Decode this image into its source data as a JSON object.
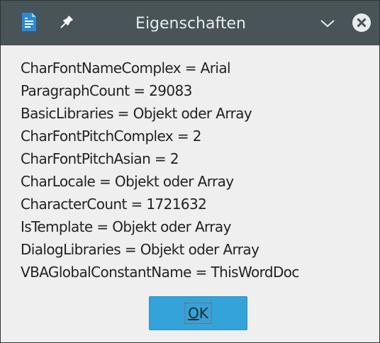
{
  "window": {
    "title": "Eigenschaften",
    "icons": {
      "app": "document-icon",
      "pin": "pin-icon",
      "menu": "chevron-down-icon",
      "close": "close-icon"
    }
  },
  "properties": [
    "CharFontNameComplex = Arial",
    "ParagraphCount = 29083",
    "BasicLibraries = Objekt oder Array",
    "CharFontPitchComplex = 2",
    "CharFontPitchAsian = 2",
    "CharLocale = Objekt oder Array",
    "CharacterCount = 1721632",
    "IsTemplate = Objekt oder Array",
    "DialogLibraries = Objekt oder Array",
    "VBAGlobalConstantName = ThisWordDoc"
  ],
  "buttons": {
    "ok_mnemonic": "O",
    "ok_rest": "K"
  },
  "colors": {
    "titlebar": "#485458",
    "dialog_bg": "#efefef",
    "accent_button": "#33a3d9"
  }
}
